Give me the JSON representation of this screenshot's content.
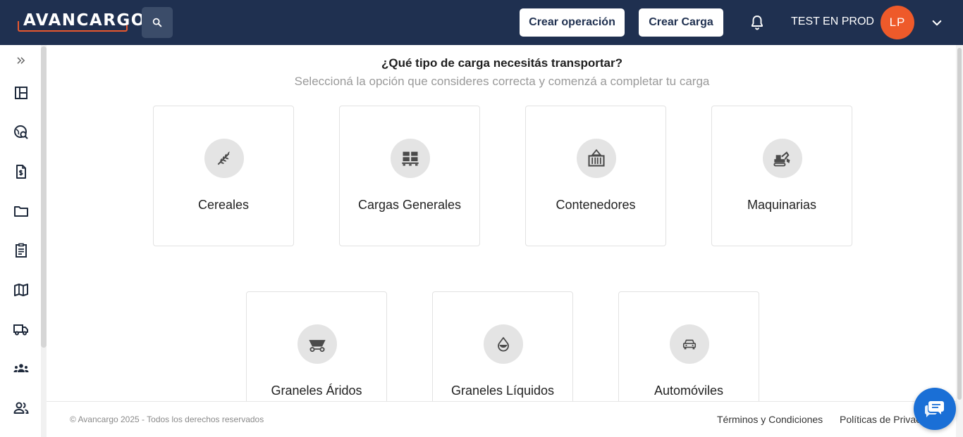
{
  "header": {
    "logo_text": "AVANCARGO",
    "create_operation_label": "Crear operación",
    "create_load_label": "Crear Carga",
    "username": "TEST EN PROD",
    "avatar_initials": "LP",
    "colors": {
      "background": "#1f3050",
      "accent": "#e8582e",
      "avatar": "#ee5a2a"
    }
  },
  "sidebar": {
    "expand_icon": "double-chevron-right-icon",
    "items": [
      {
        "name": "dashboard-icon"
      },
      {
        "name": "global-search-icon"
      },
      {
        "name": "invoice-icon"
      },
      {
        "name": "folder-icon"
      },
      {
        "name": "clipboard-icon"
      },
      {
        "name": "map-icon"
      },
      {
        "name": "truck-icon"
      },
      {
        "name": "groups-icon"
      },
      {
        "name": "users-icon"
      }
    ]
  },
  "main": {
    "title": "¿Qué tipo de carga necesitás transportar?",
    "subtitle": "Seleccioná la opción que consideres correcta y comenzá a completar tu carga",
    "cards": [
      {
        "label": "Cereales",
        "icon": "grain-icon"
      },
      {
        "label": "Cargas Generales",
        "icon": "pallet-icon"
      },
      {
        "label": "Contenedores",
        "icon": "container-icon"
      },
      {
        "label": "Maquinarias",
        "icon": "machinery-icon"
      },
      {
        "label": "Graneles Áridos",
        "icon": "bulk-hopper-icon"
      },
      {
        "label": "Graneles Líquidos",
        "icon": "liquid-drop-icon"
      },
      {
        "label": "Automóviles",
        "icon": "car-icon"
      }
    ]
  },
  "footer": {
    "copyright": "© Avancargo 2025 - Todos los derechos reservados",
    "terms_label": "Términos y Condiciones",
    "privacy_label": "Políticas de Privacidad"
  }
}
